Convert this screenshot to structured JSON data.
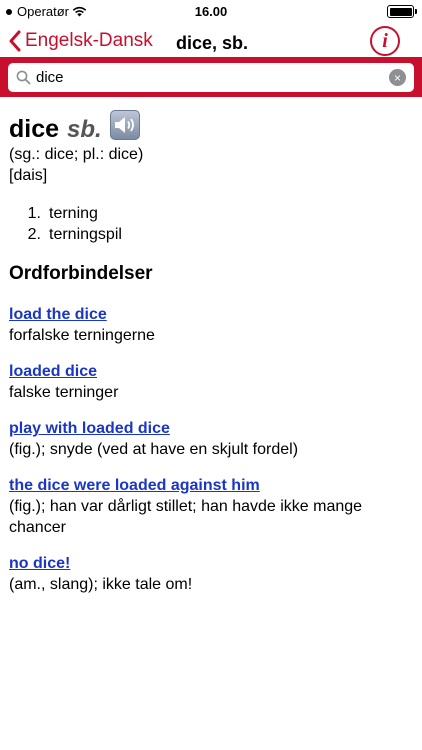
{
  "status": {
    "carrier": "Operatør",
    "time": "16.00"
  },
  "nav": {
    "back_label": "Engelsk-Dansk",
    "title": "dice, sb.",
    "info_label": "i"
  },
  "search": {
    "value": "dice",
    "clear_label": "×"
  },
  "entry": {
    "headword": "dice",
    "pos": "sb.",
    "grammar": "(sg.: dice; pl.: dice)",
    "pronunciation": "[dais]",
    "senses": [
      {
        "num": "1.",
        "text": "terning"
      },
      {
        "num": "2.",
        "text": "terningspil"
      }
    ],
    "phrases_title": "Ordforbindelser",
    "phrases": [
      {
        "phrase": "load the dice",
        "definition": "forfalske terningerne"
      },
      {
        "phrase": "loaded dice",
        "definition": "falske terninger"
      },
      {
        "phrase": "play with loaded dice",
        "definition": "(fig.); snyde (ved at have en skjult fordel)"
      },
      {
        "phrase": "the dice were loaded against him",
        "definition": "(fig.); han var dårligt stillet; han havde ikke mange chancer"
      },
      {
        "phrase": "no dice!",
        "definition": "(am., slang); ikke tale om!"
      }
    ]
  },
  "colors": {
    "accent": "#c8102e",
    "link": "#1b36c4",
    "pos": "#555555"
  },
  "icons": {
    "back": "chevron-left-icon",
    "info": "info-icon",
    "search": "search-icon",
    "clear": "clear-icon",
    "speaker": "speaker-icon",
    "wifi": "wifi-icon",
    "battery": "battery-icon"
  }
}
